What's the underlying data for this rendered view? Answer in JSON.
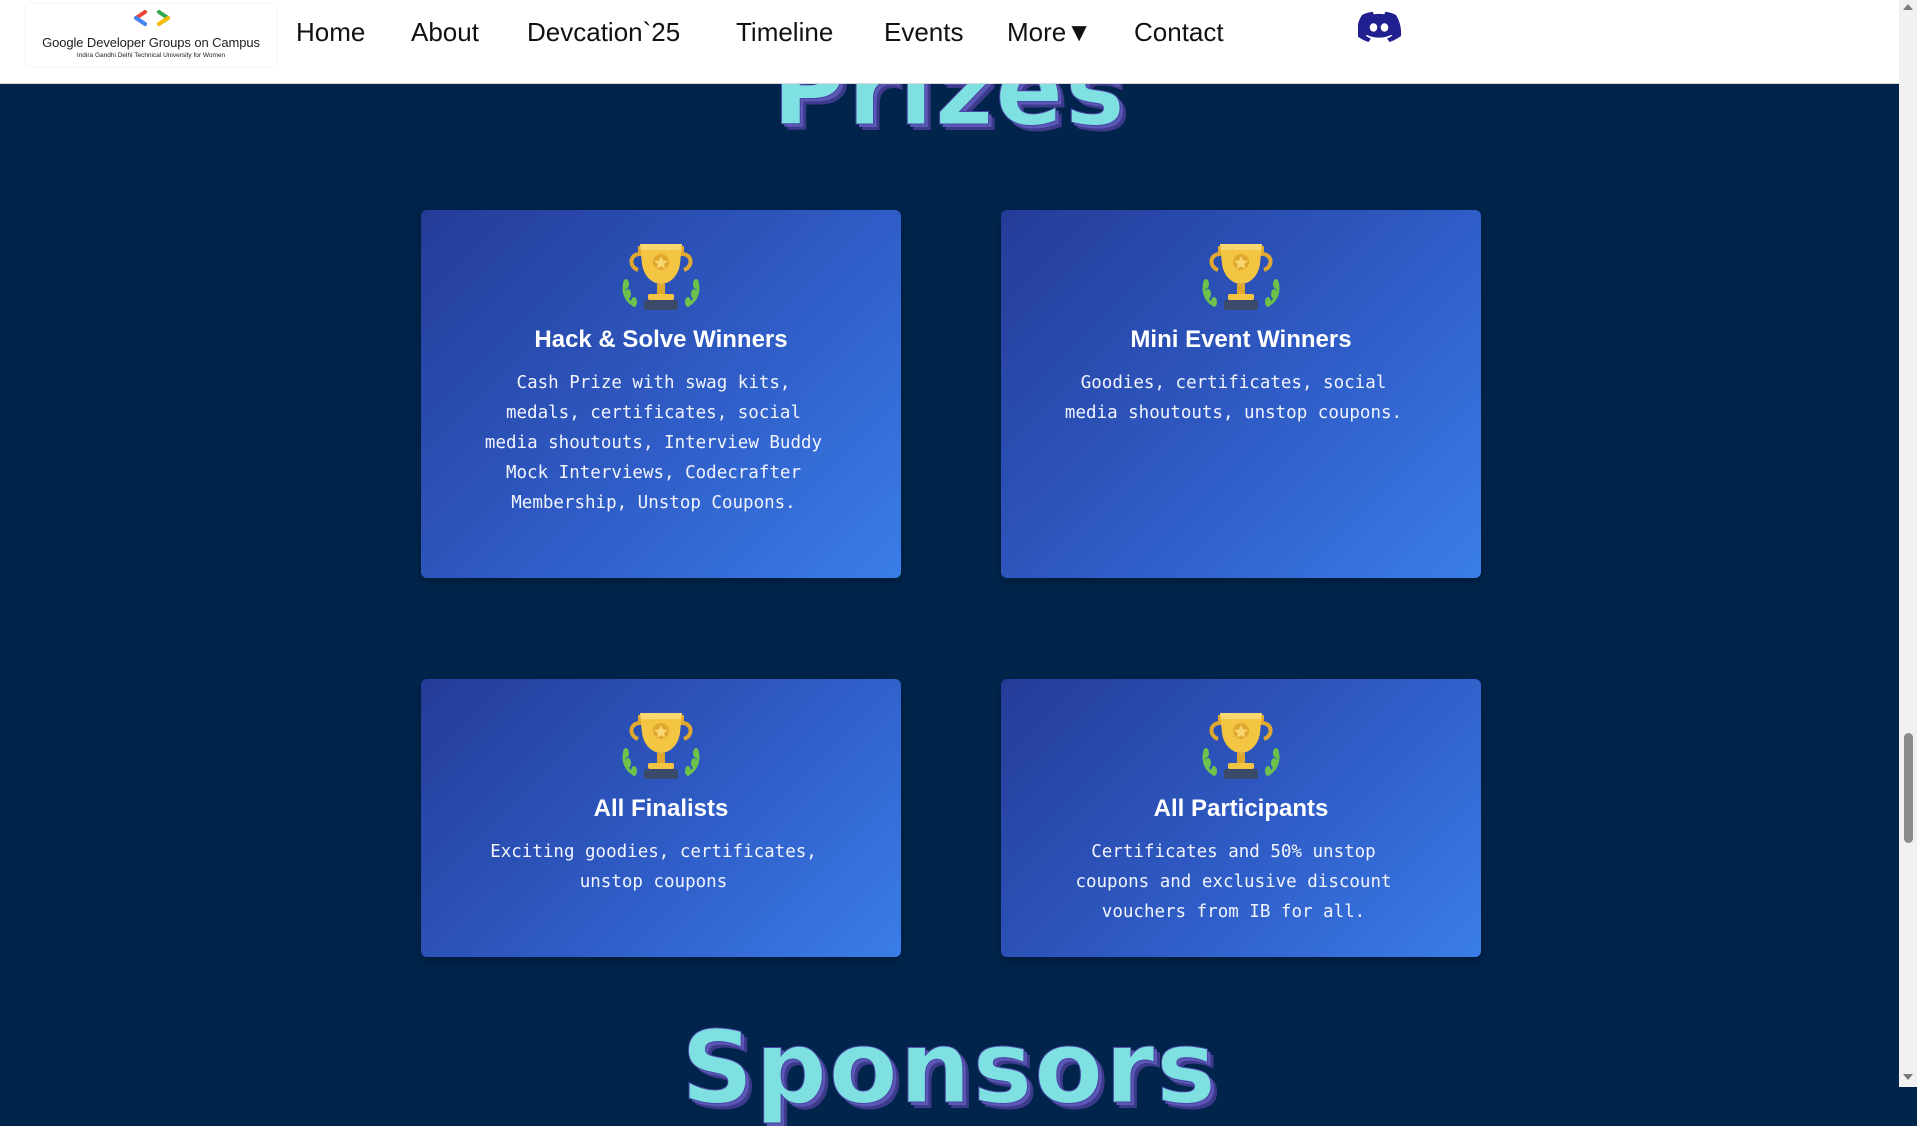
{
  "navbar": {
    "logo": {
      "title": "Google Developer Groups on Campus",
      "subtitle": "Indira Gandhi Delhi Technical University for Women"
    },
    "links": [
      {
        "label": "Home"
      },
      {
        "label": "About"
      },
      {
        "label": "Devcation`25"
      },
      {
        "label": "Timeline"
      },
      {
        "label": "Events"
      },
      {
        "label": "More▼"
      },
      {
        "label": "Contact"
      }
    ],
    "discord_icon": "discord-icon"
  },
  "prizes": {
    "heading": "Prizes",
    "cards": [
      {
        "icon": "trophy-icon",
        "title": "Hack & Solve Winners",
        "description": "Cash Prize with swag kits, medals, certificates, social media shoutouts, Interview Buddy Mock Interviews, Codecrafter Membership, Unstop Coupons."
      },
      {
        "icon": "trophy-icon",
        "title": "Mini Event Winners",
        "description": "Goodies, certificates, social media shoutouts, unstop coupons."
      },
      {
        "icon": "trophy-icon",
        "title": "All Finalists",
        "description": "Exciting goodies, certificates, unstop coupons"
      },
      {
        "icon": "trophy-icon",
        "title": "All Participants",
        "description": "Certificates and 50% unstop coupons and exclusive discount vouchers from IB for all."
      }
    ]
  },
  "sponsors": {
    "heading": "Sponsors"
  },
  "colors": {
    "page_background": "#00244b",
    "heading_fill": "#7ee0e0",
    "heading_shadow": "#5b57b5",
    "card_gradient_start": "#243c98",
    "card_gradient_end": "#3a7de8",
    "discord_brand": "#1a1a8c"
  }
}
